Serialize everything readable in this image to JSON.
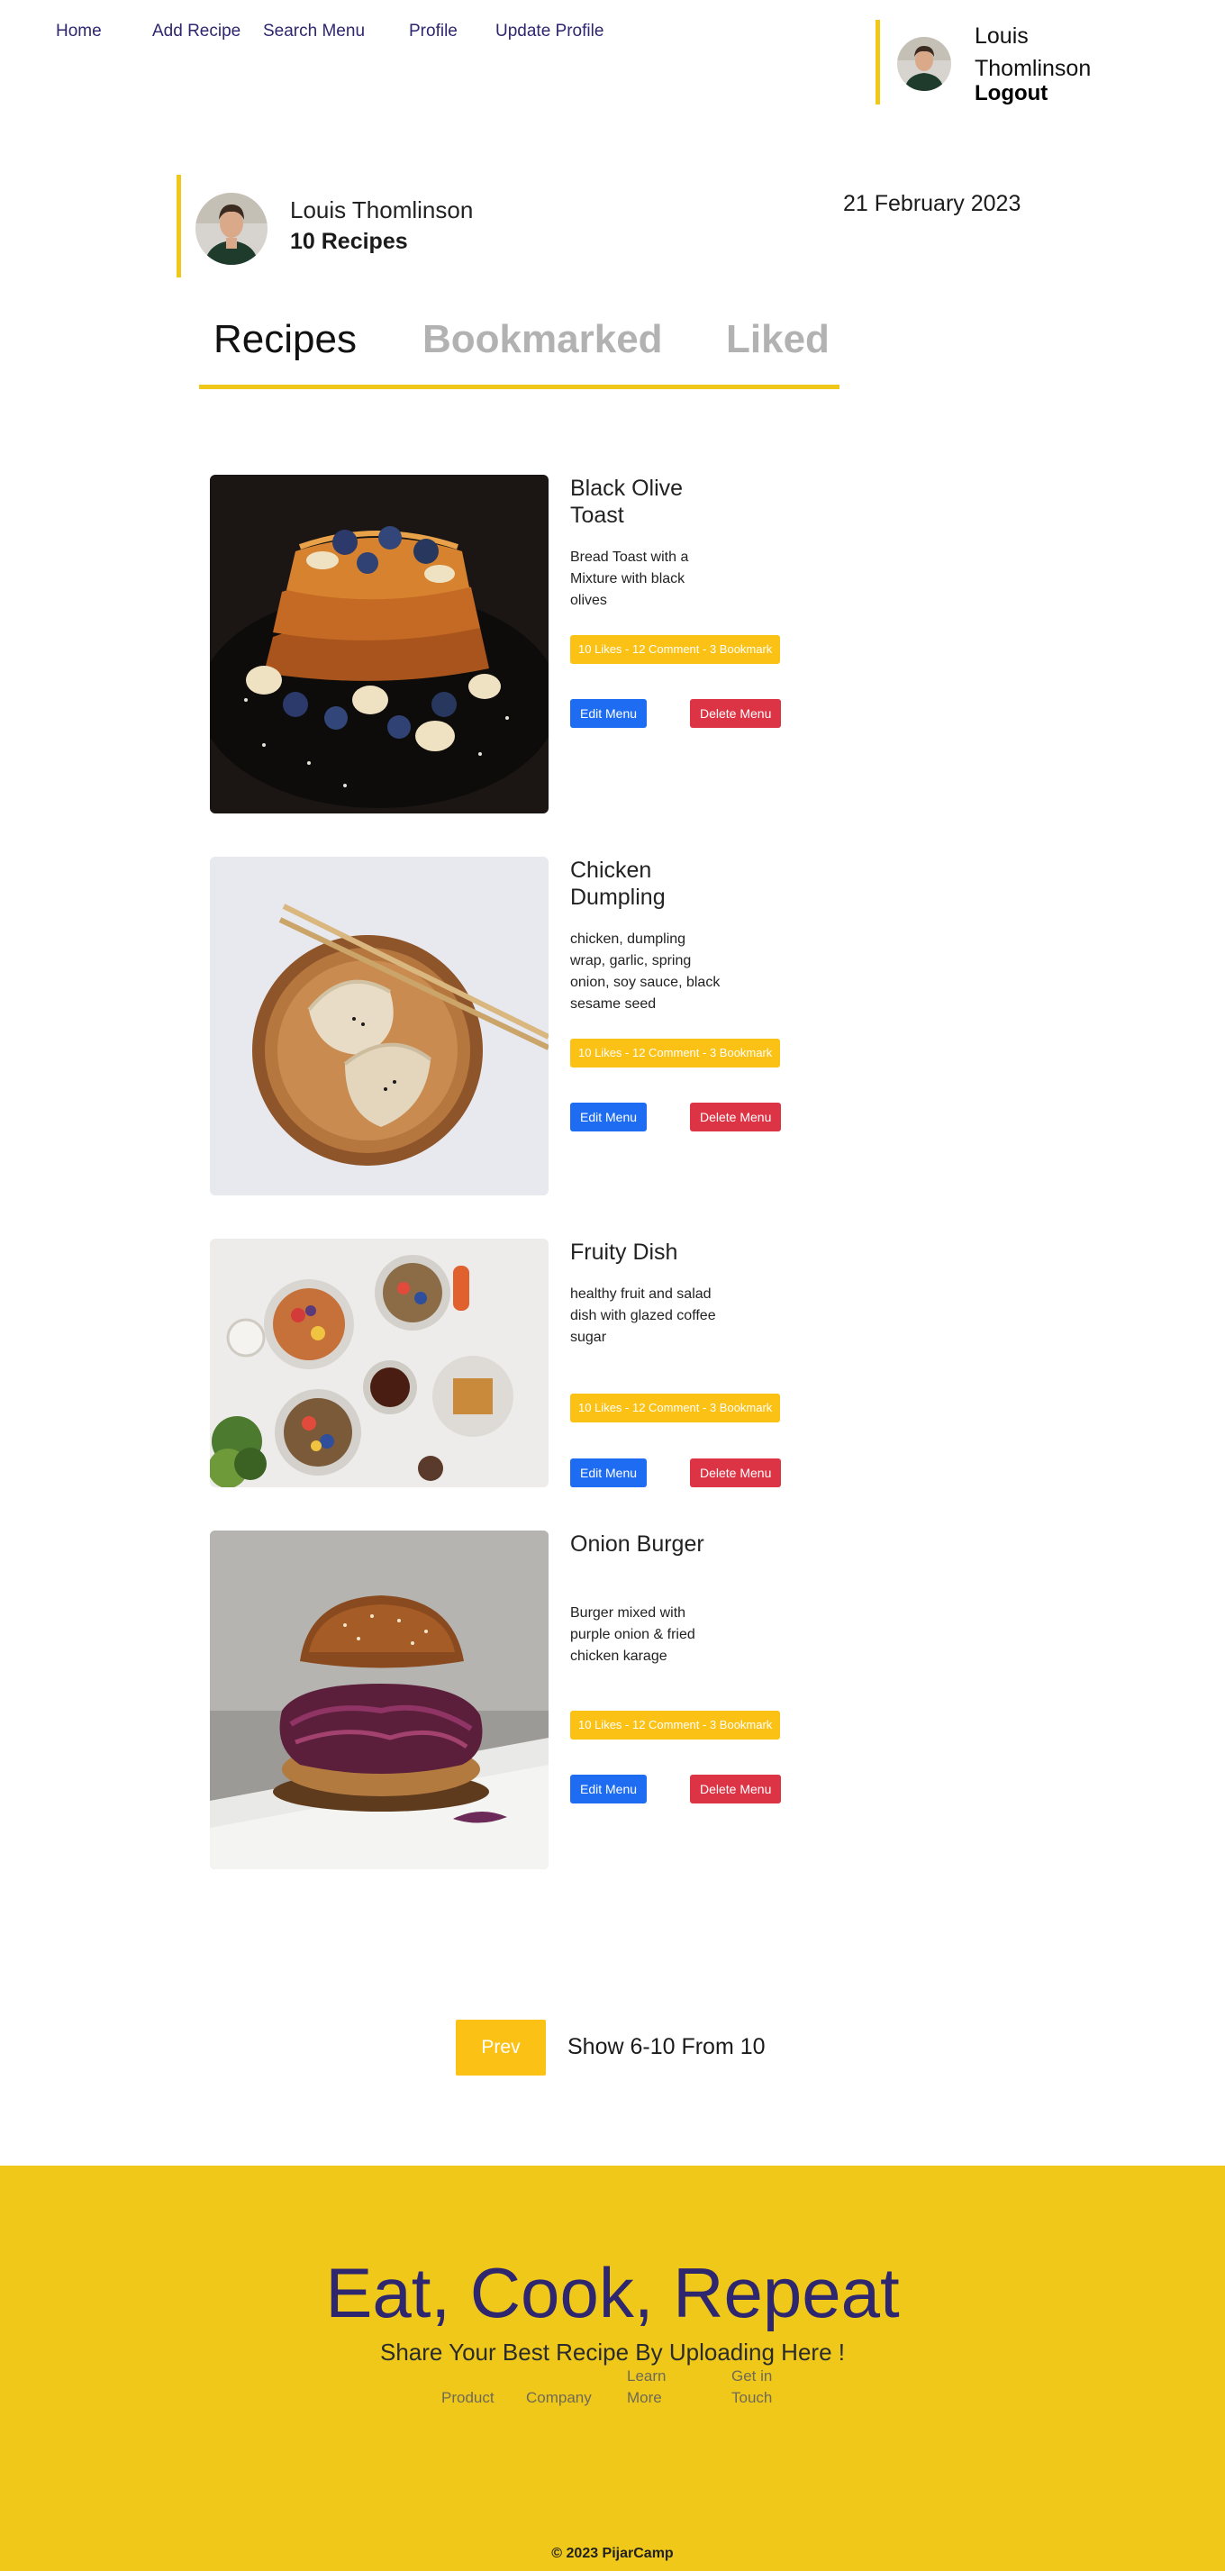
{
  "nav": {
    "links": [
      "Home",
      "Add Recipe",
      "Search Menu",
      "Profile",
      "Update Profile"
    ],
    "user_name": "Louis Thomlinson",
    "logout_label": "Logout"
  },
  "profile": {
    "name": "Louis Thomlinson",
    "recipe_count": "10 Recipes",
    "date": "21 February 2023"
  },
  "tabs": [
    {
      "label": "Recipes",
      "active": true
    },
    {
      "label": "Bookmarked",
      "active": false
    },
    {
      "label": "Liked",
      "active": false
    }
  ],
  "recipes": [
    {
      "title": "Black Olive Toast",
      "description": "Bread Toast with a Mixture with black olives",
      "stats": "10 Likes - 12 Comment - 3 Bookmark",
      "edit_label": "Edit Menu",
      "delete_label": "Delete Menu",
      "image": "french-toast-photo"
    },
    {
      "title": "Chicken Dumpling",
      "description": "chicken, dumpling wrap, garlic, spring onion, soy sauce, black sesame seed",
      "stats": "10 Likes - 12 Comment - 3 Bookmark",
      "edit_label": "Edit Menu",
      "delete_label": "Delete Menu",
      "image": "dumpling-photo"
    },
    {
      "title": "Fruity Dish",
      "description": "healthy fruit and salad dish with glazed coffee sugar",
      "stats": "10 Likes - 12 Comment - 3 Bookmark",
      "edit_label": "Edit Menu",
      "delete_label": "Delete Menu",
      "image": "fruit-bowls-photo"
    },
    {
      "title": "Onion Burger",
      "description": "Burger mixed with purple onion & fried chicken karage",
      "stats": "10 Likes - 12 Comment - 3 Bookmark",
      "edit_label": "Edit Menu",
      "delete_label": "Delete Menu",
      "image": "burger-photo"
    }
  ],
  "pagination": {
    "prev_label": "Prev",
    "info": "Show 6-10 From 10"
  },
  "footer": {
    "title": "Eat, Cook, Repeat",
    "subtitle": "Share Your Best Recipe By Uploading Here !",
    "links": [
      "Product",
      "Company",
      "Learn More",
      "Get in Touch"
    ],
    "copyright": "© 2023 PijarCamp"
  },
  "colors": {
    "accent": "#efc81a",
    "nav_text": "#2e266f",
    "stats_badge": "#fbc114",
    "edit_button": "#1e6cf2",
    "delete_button": "#dc3445"
  }
}
